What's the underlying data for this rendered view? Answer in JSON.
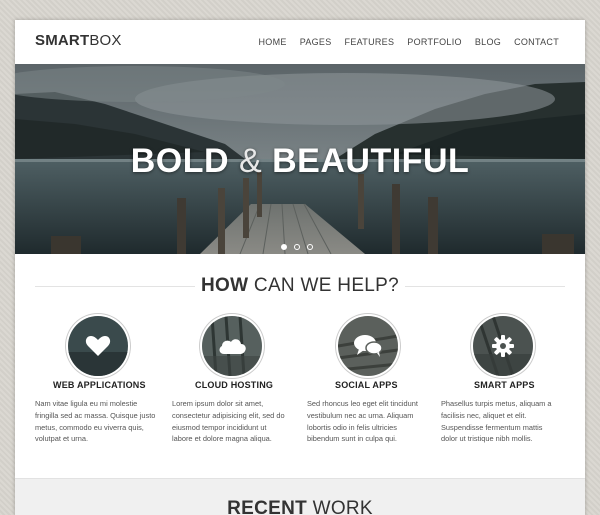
{
  "brand": {
    "logo_bold": "SMART",
    "logo_light": "BOX"
  },
  "nav": {
    "items": [
      "HOME",
      "PAGES",
      "FEATURES",
      "PORTFOLIO",
      "BLOG",
      "CONTACT"
    ]
  },
  "hero": {
    "title_bold_1": "BOLD",
    "title_amp": "&",
    "title_bold_2": "BEAUTIFUL",
    "slide_count": 3,
    "active_slide": 1
  },
  "help": {
    "title_bold": "HOW",
    "title_light": "CAN WE HELP?"
  },
  "services": [
    {
      "title": "WEB APPLICATIONS",
      "icon": "heart-icon",
      "text": [
        "Nam vitae ligula eu mi molestie",
        "fringilla sed ac massa. Quisque justo",
        "metus, commodo eu viverra quis,",
        "volutpat et urna."
      ]
    },
    {
      "title": "CLOUD HOSTING",
      "icon": "cloud-icon",
      "text": [
        "Lorem ipsum dolor sit amet,",
        "consectetur adipisicing elit, sed do",
        "eiusmod tempor incididunt ut",
        "labore et dolore magna aliqua."
      ]
    },
    {
      "title": "SOCIAL APPS",
      "icon": "chat-icon",
      "text": [
        "Sed rhoncus leo eget elit tincidunt",
        "vestibulum nec ac urna. Aliquam",
        "lobortis odio in felis ultricies",
        "bibendum sunt in culpa qui."
      ]
    },
    {
      "title": "SMART APPS",
      "icon": "gear-icon",
      "text": [
        "Phasellus turpis metus, aliquam a",
        "facilisis nec, aliquet et elit.",
        "Suspendisse fermentum mattis",
        "dolor ut tristique nibh mollis."
      ]
    }
  ],
  "recent": {
    "title_bold": "RECENT",
    "title_light": "WORK"
  },
  "colors": {
    "text_dark": "#333333",
    "hero_water": "#2f3d40",
    "icon_circle": "#3a4a4c"
  }
}
